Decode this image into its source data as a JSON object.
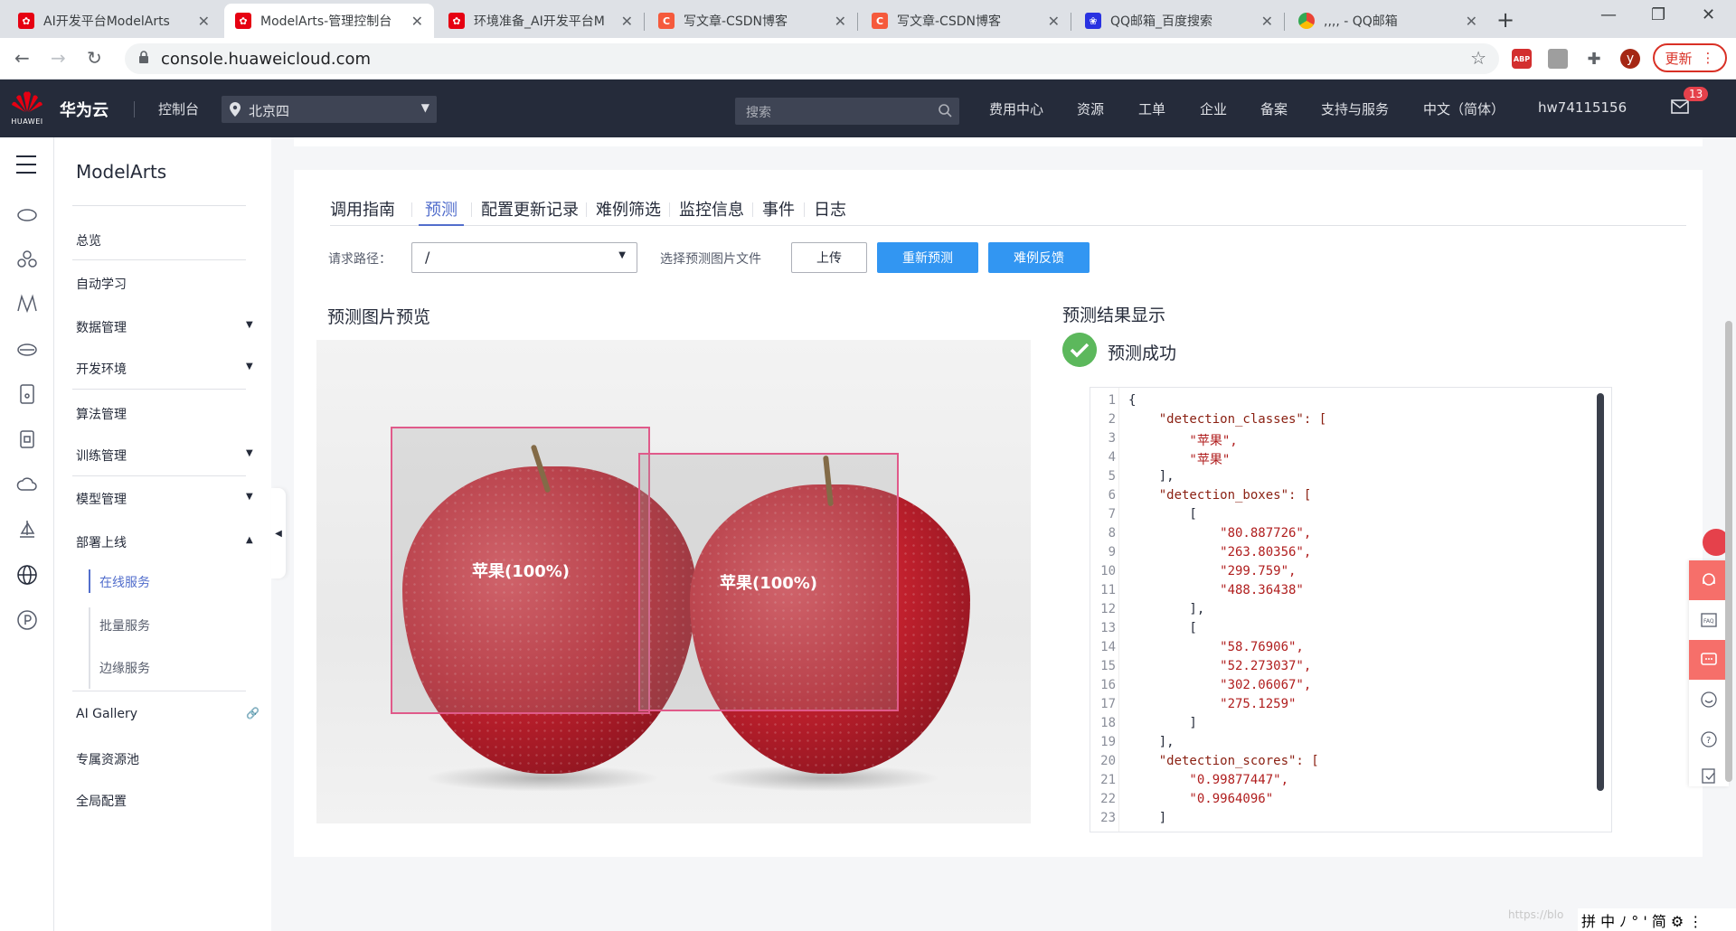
{
  "browser": {
    "tabs": [
      {
        "title": "AI开发平台ModelArts",
        "favicon": "huawei-icon",
        "active": false
      },
      {
        "title": "ModelArts-管理控制台",
        "favicon": "huawei-icon",
        "active": true
      },
      {
        "title": "环境准备_AI开发平台M",
        "favicon": "huawei-icon",
        "active": false
      },
      {
        "title": "写文章-CSDN博客",
        "favicon": "csdn-icon",
        "active": false
      },
      {
        "title": "写文章-CSDN博客",
        "favicon": "csdn-icon",
        "active": false
      },
      {
        "title": "QQ邮箱_百度搜索",
        "favicon": "baidu-icon",
        "active": false
      },
      {
        "title": ",,,, - QQ邮箱",
        "favicon": "chrome-icon",
        "active": false
      }
    ],
    "url": "console.huaweicloud.com",
    "update_label": "更新",
    "profile_initial": "y",
    "abp_label": "ABP"
  },
  "topnav": {
    "logo_label": "HUAWEI",
    "brand": "华为云",
    "console": "控制台",
    "region": "北京四",
    "search_placeholder": "搜索",
    "links": [
      "费用中心",
      "资源",
      "工单",
      "企业",
      "备案",
      "支持与服务",
      "中文（简体）",
      "hw74115156"
    ],
    "mail_count": "13"
  },
  "sidebar": {
    "title": "ModelArts",
    "items": [
      {
        "label": "总览",
        "caret": ""
      },
      {
        "label": "自动学习",
        "caret": ""
      },
      {
        "label": "数据管理",
        "caret": "▼"
      },
      {
        "label": "开发环境",
        "caret": "▼"
      },
      {
        "label": "算法管理",
        "caret": ""
      },
      {
        "label": "训练管理",
        "caret": "▼"
      },
      {
        "label": "模型管理",
        "caret": "▼"
      },
      {
        "label": "部署上线",
        "caret": "▲"
      }
    ],
    "sub_items": [
      {
        "label": "在线服务",
        "active": true
      },
      {
        "label": "批量服务",
        "active": false
      },
      {
        "label": "边缘服务",
        "active": false
      }
    ],
    "bottom_items": [
      "AI Gallery",
      "专属资源池",
      "全局配置"
    ]
  },
  "main": {
    "tabs": [
      "调用指南",
      "预测",
      "配置更新记录",
      "难例筛选",
      "监控信息",
      "事件",
      "日志"
    ],
    "active_tab": "预测",
    "request_path_label": "请求路径：",
    "request_path_value": "/",
    "choose_file_label": "选择预测图片文件",
    "upload_button": "上传",
    "repredict_button": "重新预测",
    "hard_example_button": "难例反馈",
    "preview_title": "预测图片预览",
    "result_title": "预测结果显示",
    "status": "预测成功",
    "detections": [
      {
        "label": "苹果(100%)"
      },
      {
        "label": "苹果(100%)"
      }
    ],
    "json_lines": [
      "{",
      "    \"detection_classes\": [",
      "        \"苹果\",",
      "        \"苹果\"",
      "    ],",
      "    \"detection_boxes\": [",
      "        [",
      "            \"80.887726\",",
      "            \"263.80356\",",
      "            \"299.759\",",
      "            \"488.36438\"",
      "        ],",
      "        [",
      "            \"58.76906\",",
      "            \"52.273037\",",
      "            \"302.06067\",",
      "            \"275.1259\"",
      "        ]",
      "    ],",
      "    \"detection_scores\": [",
      "        \"0.99877447\",",
      "        \"0.9964096\"",
      "    ]"
    ]
  },
  "ime": {
    "text": "拼 中 ﾉ ° ' 简 ⚙ ⋮"
  },
  "watermark": "https://blo",
  "colors": {
    "accent": "#526ecc",
    "primary_button": "#3296f2",
    "topnav_bg": "#252b3a",
    "success": "#5cb85c",
    "box_border": "#e05a8a"
  }
}
